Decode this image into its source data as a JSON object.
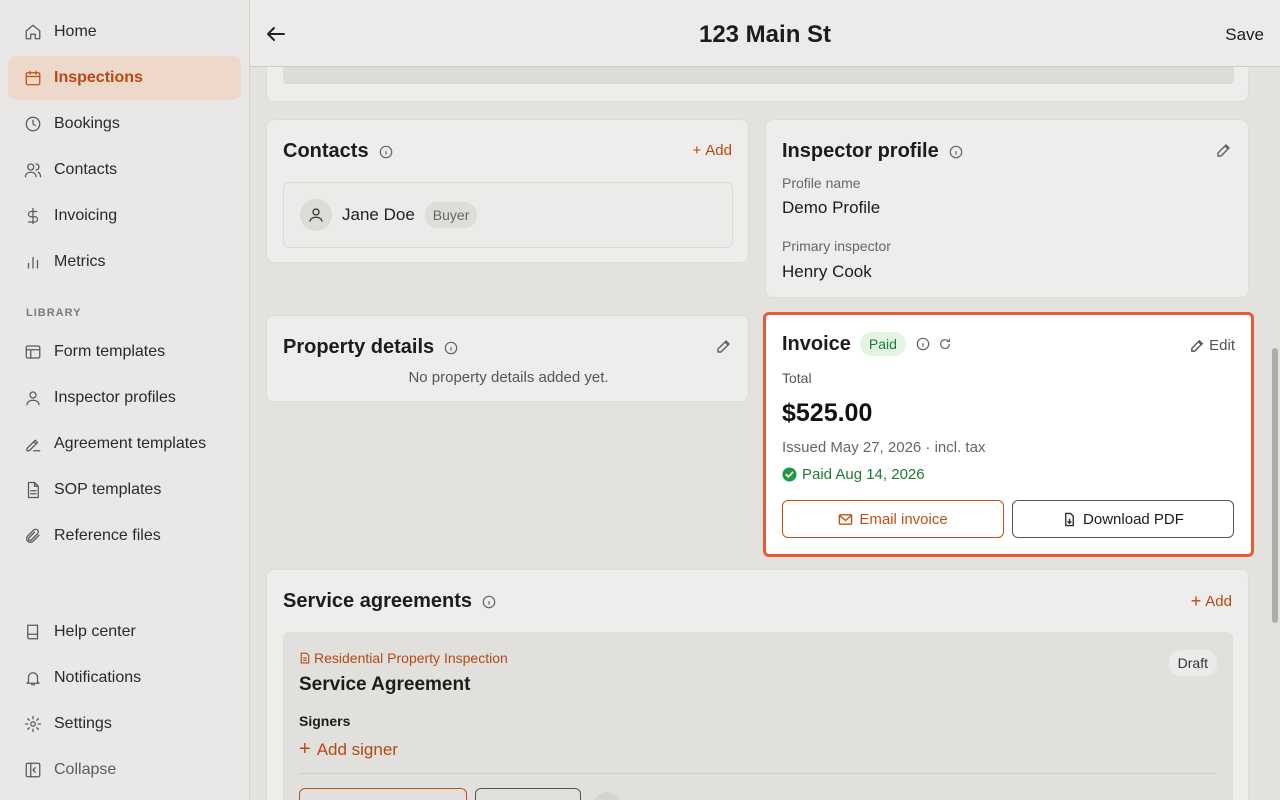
{
  "sidebar": {
    "items": [
      {
        "label": "Home",
        "icon": "home-icon"
      },
      {
        "label": "Inspections",
        "icon": "calendar-icon"
      },
      {
        "label": "Bookings",
        "icon": "clock-icon"
      },
      {
        "label": "Contacts",
        "icon": "users-icon"
      },
      {
        "label": "Invoicing",
        "icon": "dollar-icon"
      },
      {
        "label": "Metrics",
        "icon": "bar-chart-icon"
      }
    ],
    "library_label": "LIBRARY",
    "library_items": [
      {
        "label": "Form templates",
        "icon": "layout-icon"
      },
      {
        "label": "Inspector profiles",
        "icon": "user-icon"
      },
      {
        "label": "Agreement templates",
        "icon": "signature-icon"
      },
      {
        "label": "SOP templates",
        "icon": "file-icon"
      },
      {
        "label": "Reference files",
        "icon": "paperclip-icon"
      }
    ],
    "bottom_items": [
      {
        "label": "Help center",
        "icon": "book-icon"
      },
      {
        "label": "Notifications",
        "icon": "bell-icon"
      },
      {
        "label": "Settings",
        "icon": "gear-icon"
      },
      {
        "label": "Collapse",
        "icon": "sidebar-collapse-icon"
      }
    ],
    "active_color": "#b9470f"
  },
  "header": {
    "title": "123 Main St",
    "save_label": "Save"
  },
  "contacts": {
    "title": "Contacts",
    "add_label": "Add",
    "items": [
      {
        "name": "Jane Doe",
        "role": "Buyer"
      }
    ]
  },
  "inspector_profile": {
    "title": "Inspector profile",
    "profile_name_label": "Profile name",
    "profile_name": "Demo Profile",
    "primary_inspector_label": "Primary inspector",
    "primary_inspector": "Henry Cook"
  },
  "property_details": {
    "title": "Property details",
    "empty_text": "No property details added yet."
  },
  "invoice": {
    "title": "Invoice",
    "status": "Paid",
    "edit_label": "Edit",
    "total_label": "Total",
    "total": "$525.00",
    "issued": "Issued May 27, 2026 · incl. tax",
    "paid_text": "Paid Aug 14, 2026",
    "email_label": "Email invoice",
    "download_label": "Download PDF",
    "highlight_color": "#e8593a"
  },
  "service_agreements": {
    "title": "Service agreements",
    "add_label": "Add",
    "agreement": {
      "template_name": "Residential Property Inspection",
      "title": "Service Agreement",
      "status": "Draft",
      "signers_label": "Signers",
      "add_signer_label": "Add signer"
    }
  }
}
